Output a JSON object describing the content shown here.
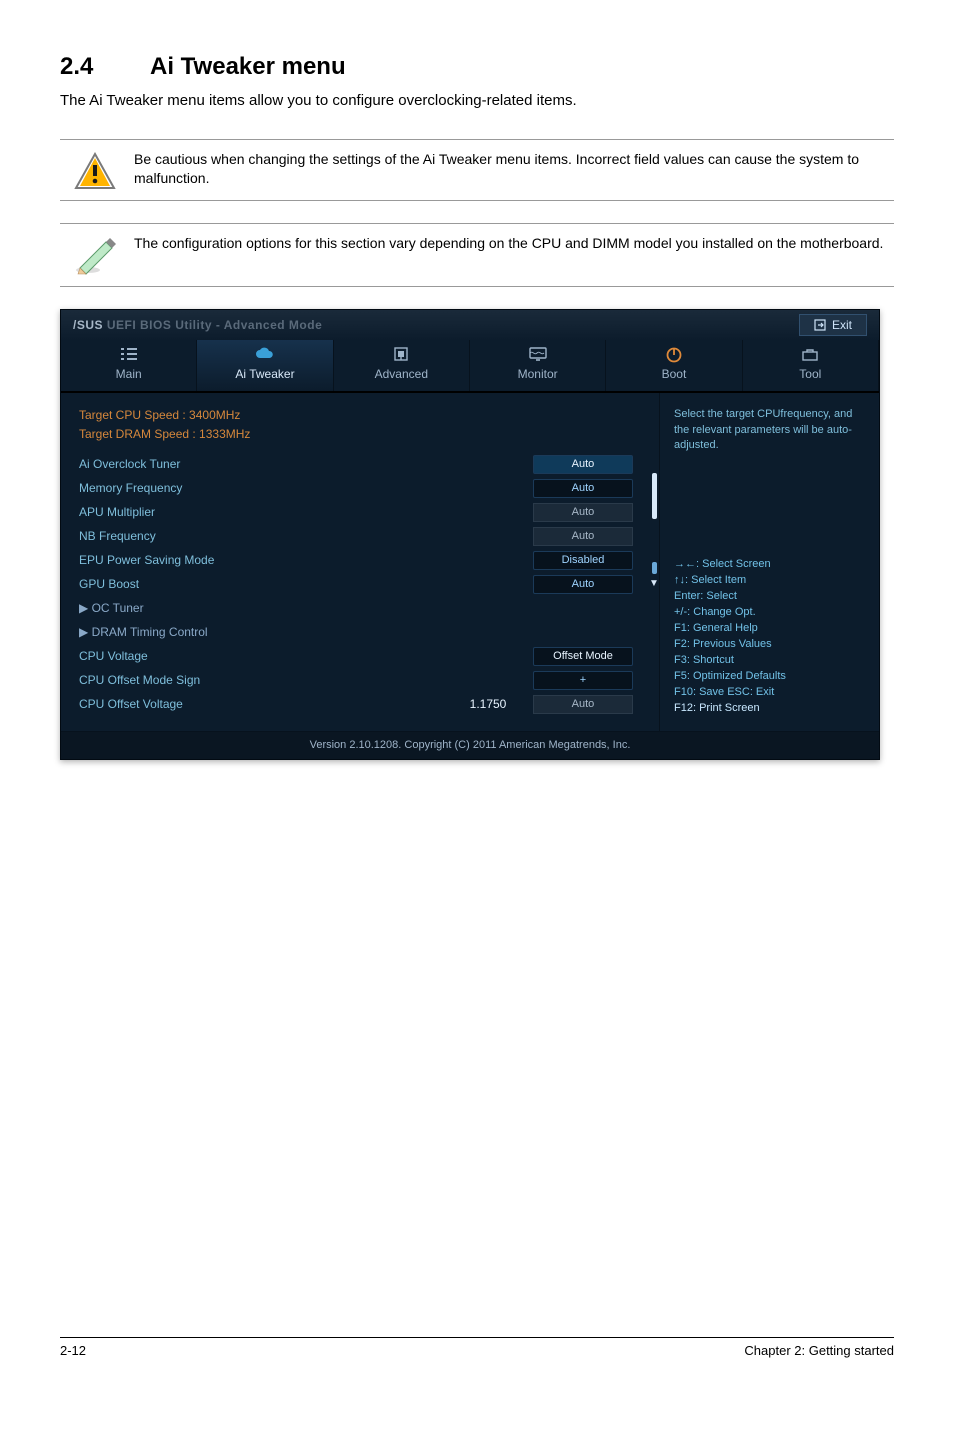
{
  "page": {
    "section_number": "2.4",
    "section_title": "Ai Tweaker menu",
    "intro": "The Ai Tweaker menu items allow you to configure overclocking-related items.",
    "footer_left": "2-12",
    "footer_right": "Chapter 2: Getting started"
  },
  "notes": {
    "warning": "Be cautious when changing the settings of the Ai Tweaker menu items. Incorrect field values can cause the system to malfunction.",
    "info": "The configuration options for this section vary depending on the CPU and DIMM model you installed on the motherboard."
  },
  "bios": {
    "brand_prefix": "/SUS",
    "brand_rest": " UEFI BIOS Utility - Advanced Mode",
    "exit": "Exit",
    "tabs": {
      "main": "Main",
      "tweaker": "Ai Tweaker",
      "advanced": "Advanced",
      "monitor": "Monitor",
      "boot": "Boot",
      "tool": "Tool"
    },
    "targets": {
      "cpu": "Target CPU Speed : 3400MHz",
      "dram": "Target DRAM Speed : 1333MHz"
    },
    "settings": {
      "overclock_tuner": {
        "label": "Ai Overclock Tuner",
        "value": "Auto"
      },
      "memory_frequency": {
        "label": "Memory Frequency",
        "value": "Auto"
      },
      "apu_multiplier": {
        "label": "APU Multiplier",
        "value": "Auto"
      },
      "nb_frequency": {
        "label": "NB Frequency",
        "value": "Auto"
      },
      "epu_mode": {
        "label": "EPU Power Saving Mode",
        "value": "Disabled"
      },
      "gpu_boost": {
        "label": "GPU Boost",
        "value": "Auto"
      },
      "oc_tuner": {
        "label": "OC Tuner",
        "value": ""
      },
      "dram_timing": {
        "label": "DRAM Timing Control",
        "value": ""
      },
      "cpu_voltage": {
        "label": "CPU Voltage",
        "value": "Offset Mode"
      },
      "offset_sign": {
        "label": "CPU Offset Mode Sign",
        "value": "+"
      },
      "offset_voltage": {
        "label": "CPU Offset Voltage",
        "value_left": "1.1750",
        "value_right": "Auto"
      }
    },
    "help_top": "Select the target CPUfrequency, and the relevant parameters will be auto-adjusted.",
    "help_keys": {
      "l1": "→←: Select Screen",
      "l2": "↑↓: Select Item",
      "l3": "Enter: Select",
      "l4": "+/-: Change Opt.",
      "l5": "F1: General Help",
      "l6": "F2: Previous Values",
      "l7": "F3: Shortcut",
      "l8": "F5: Optimized Defaults",
      "l9": "F10: Save   ESC: Exit",
      "l10": "F12: Print Screen"
    },
    "footer": "Version 2.10.1208. Copyright (C) 2011 American Megatrends, Inc."
  }
}
